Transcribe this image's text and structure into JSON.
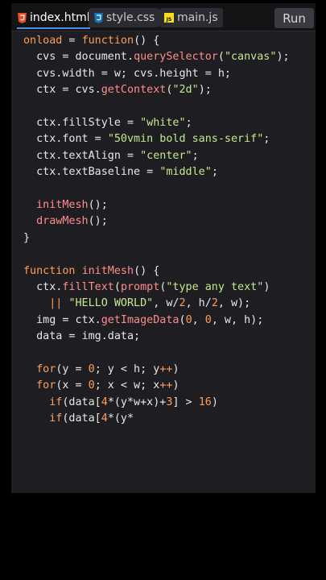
{
  "tabs": [
    {
      "label": "index.html",
      "icon": "html5-icon",
      "color": "#e44d26",
      "active": true
    },
    {
      "label": "style.css",
      "icon": "css3-icon",
      "color": "#1572b6",
      "active": false
    },
    {
      "label": "main.js",
      "icon": "js-icon",
      "color": "#f7df1e",
      "active": false
    }
  ],
  "run_label": "Run",
  "code_lines": [
    "onload = function() {",
    "  cvs = document.querySelector(\"canvas\");",
    "  cvs.width = w; cvs.height = h;",
    "  ctx = cvs.getContext(\"2d\");",
    "",
    "  ctx.fillStyle = \"white\";",
    "  ctx.font = \"50vmin bold sans-serif\";",
    "  ctx.textAlign = \"center\";",
    "  ctx.textBaseline = \"middle\";",
    "",
    "  initMesh();",
    "  drawMesh();",
    "}",
    "",
    "function initMesh() {",
    "  ctx.fillText(prompt(\"type any text\")",
    "    || \"HELLO WORLD\", w/2, h/2, w);",
    "  img = ctx.getImageData(0, 0, w, h);",
    "  data = img.data;",
    "",
    "  for(y = 0; y < h; y++)",
    "  for(x = 0; x < w; x++)",
    "    if(data[4*(y*w+x)+3] > 16)",
    "    if(data[4*(y*"
  ],
  "colors": {
    "background": "#000000",
    "editor_bg": "#1e1e22",
    "keyword": "#ff9e57",
    "function": "#ff8c8c",
    "string": "#c3e88d"
  }
}
